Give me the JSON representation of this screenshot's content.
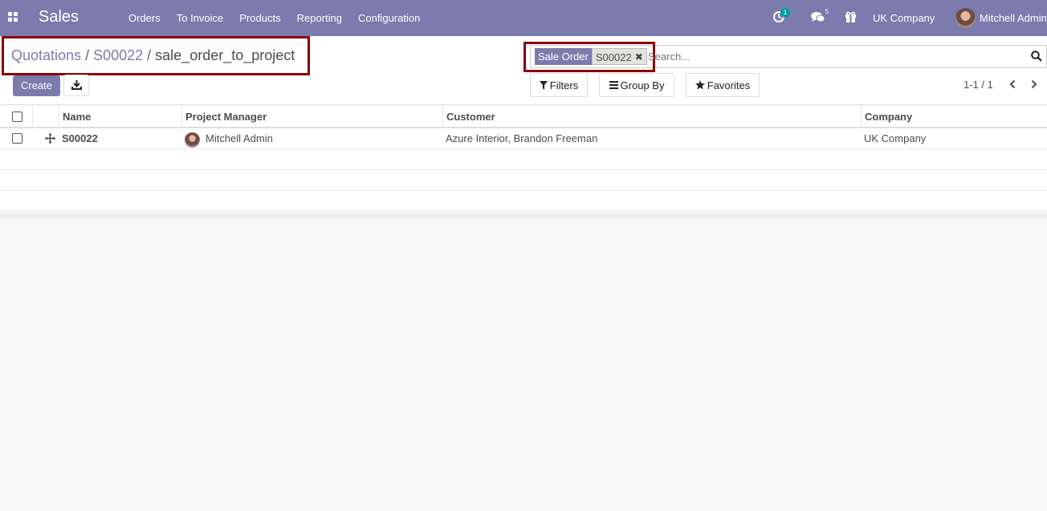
{
  "navbar": {
    "app_name": "Sales",
    "menu": [
      "Orders",
      "To Invoice",
      "Products",
      "Reporting",
      "Configuration"
    ],
    "activity_badge": "1",
    "messages_badge": "5",
    "company": "UK Company",
    "user": "Mitchell Admin",
    "bg_color": "#7c7bad"
  },
  "breadcrumb": {
    "items": [
      "Quotations",
      "S00022"
    ],
    "separator": "/",
    "current": "sale_order_to_project"
  },
  "buttons": {
    "create": "Create"
  },
  "search": {
    "facet_label": "Sale Order",
    "facet_value": "S00022",
    "facet_remove": "✖",
    "placeholder": "Search..."
  },
  "filters": {
    "filters": "Filters",
    "group_by": "Group By",
    "favorites": "Favorites"
  },
  "pager": {
    "value": "1-1 / 1"
  },
  "table": {
    "columns": [
      "Name",
      "Project Manager",
      "Customer",
      "Company"
    ],
    "rows": [
      {
        "name": "S00022",
        "project_manager": "Mitchell Admin",
        "customer": "Azure Interior, Brandon Freeman",
        "company": "UK Company"
      }
    ]
  },
  "highlight_color": "#8b0000"
}
